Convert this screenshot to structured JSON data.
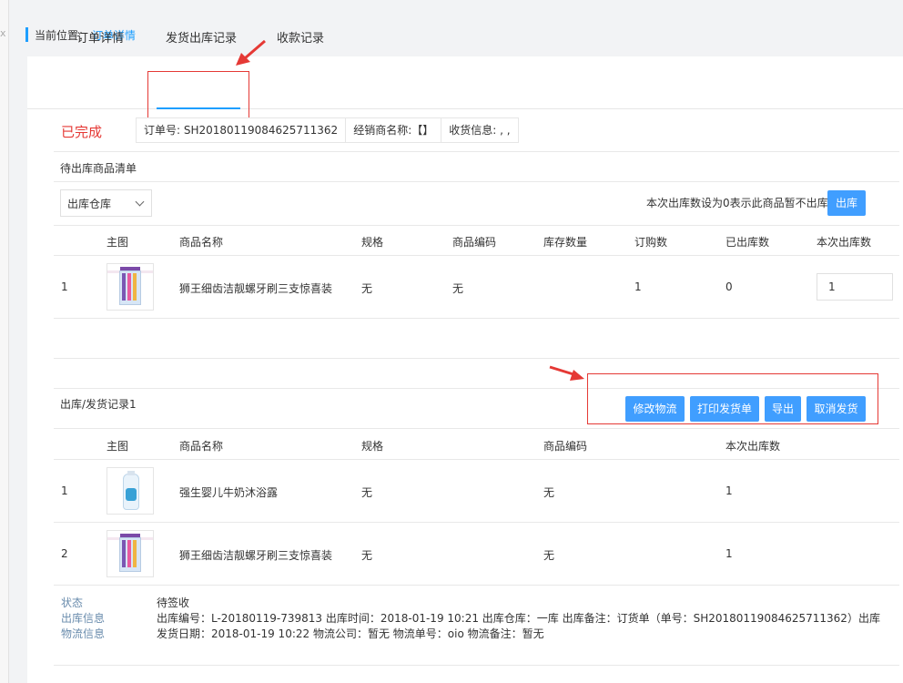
{
  "breadcrumb": {
    "label": "当前位置：",
    "current": "订单详情"
  },
  "left_strip": {
    "close_glyph": "x"
  },
  "tabs": [
    {
      "label": "订单详情",
      "active": false
    },
    {
      "label": "发货出库记录",
      "active": true
    },
    {
      "label": "收款记录",
      "active": false
    }
  ],
  "order": {
    "status": "已完成",
    "order_no": "订单号: SH20180119084625711362",
    "dealer": "经销商名称:【】",
    "receiver": "收货信息: , ,"
  },
  "pending": {
    "title": "待出库商品清单",
    "warehouse_select": "出库仓库",
    "hint": "本次出库数设为0表示此商品暂不出库",
    "outbound_button": "出库",
    "columns": [
      "主图",
      "商品名称",
      "规格",
      "商品编码",
      "库存数量",
      "订购数",
      "已出库数",
      "本次出库数"
    ],
    "rows": [
      {
        "index": "1",
        "image": "toothbrush-pack",
        "name": "狮王细齿洁靓螺牙刷三支惊喜装",
        "spec": "无",
        "code": "无",
        "stock": "",
        "ordered": "1",
        "shipped": "0",
        "this_qty": "1"
      }
    ]
  },
  "record": {
    "title": "出库/发货记录1",
    "buttons": [
      "修改物流",
      "打印发货单",
      "导出",
      "取消发货"
    ],
    "columns": [
      "主图",
      "商品名称",
      "规格",
      "商品编码",
      "本次出库数"
    ],
    "rows": [
      {
        "index": "1",
        "image": "body-wash-bottle",
        "name": "强生婴儿牛奶沐浴露",
        "spec": "无",
        "code": "无",
        "qty": "1"
      },
      {
        "index": "2",
        "image": "toothbrush-pack",
        "name": "狮王细齿洁靓螺牙刷三支惊喜装",
        "spec": "无",
        "code": "无",
        "qty": "1"
      }
    ],
    "meta": {
      "status_label": "状态",
      "status_value": "待签收",
      "outbound_label": "出库信息",
      "outbound_value": "出库编号：L-20180119-739813   出库时间：2018-01-19 10:21   出库仓库：一库   出库备注：订货单（单号：SH20180119084625711362）出库",
      "logistics_label": "物流信息",
      "logistics_value": "发货日期：2018-01-19 10:22   物流公司：暂无   物流单号：oio   物流备注：暂无"
    }
  },
  "colors": {
    "accent": "#1e9fff",
    "button": "#409eff",
    "alert": "#e53935"
  }
}
